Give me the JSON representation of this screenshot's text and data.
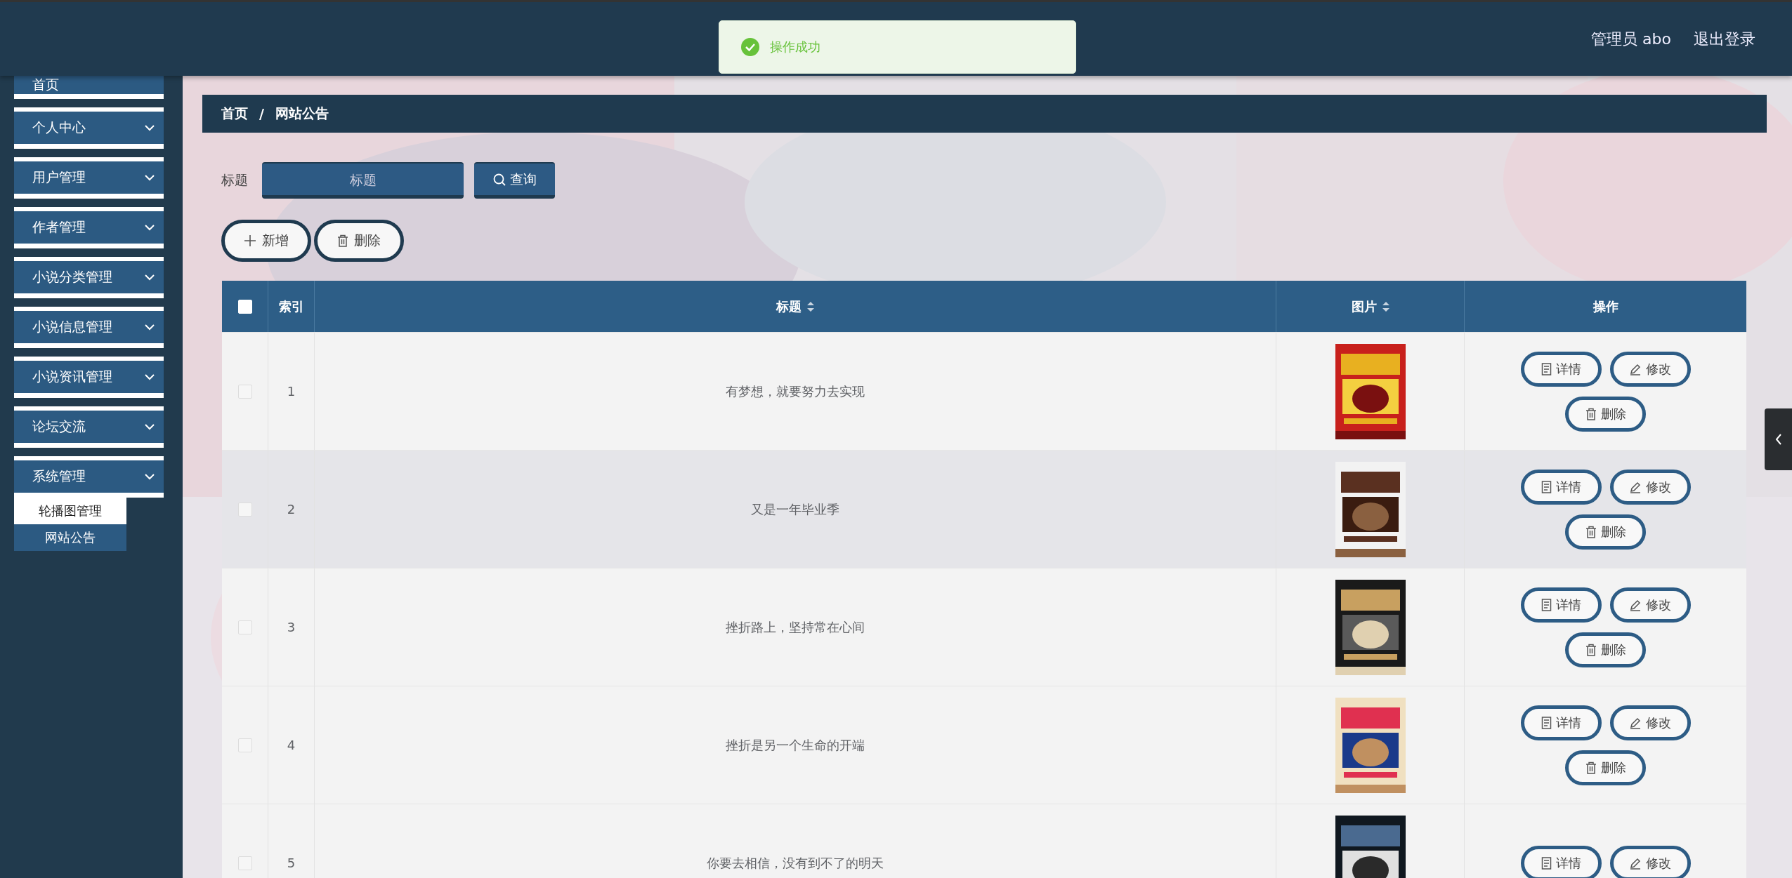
{
  "topbar": {
    "user": "管理员 abo",
    "logout": "退出登录"
  },
  "toast": {
    "message": "操作成功"
  },
  "sidebar": {
    "items": [
      {
        "kind": "link",
        "label": "首页"
      },
      {
        "kind": "menu",
        "label": "个人中心"
      },
      {
        "kind": "menu",
        "label": "用户管理"
      },
      {
        "kind": "menu",
        "label": "作者管理"
      },
      {
        "kind": "menu",
        "label": "小说分类管理"
      },
      {
        "kind": "menu",
        "label": "小说信息管理"
      },
      {
        "kind": "menu",
        "label": "小说资讯管理"
      },
      {
        "kind": "menu",
        "label": "论坛交流"
      },
      {
        "kind": "menu",
        "label": "系统管理",
        "children": [
          {
            "label": "轮播图管理",
            "selected": true
          },
          {
            "label": "网站公告",
            "selected": false
          }
        ]
      }
    ]
  },
  "breadcrumb": {
    "items": [
      "首页",
      "网站公告"
    ],
    "separator": "/"
  },
  "search": {
    "label": "标题",
    "placeholder": "标题",
    "button": "查询"
  },
  "actions": [
    {
      "kind": "add",
      "label": "新增"
    },
    {
      "kind": "delete",
      "label": "删除"
    }
  ],
  "table": {
    "select_all": {
      "checked": false
    },
    "columns": [
      {
        "label": "索引",
        "sortable": false
      },
      {
        "label": "标题",
        "sortable": true
      },
      {
        "label": "图片",
        "sortable": true
      },
      {
        "label": "操作",
        "sortable": false
      }
    ],
    "rows": [
      {
        "checked": false,
        "hovered": false,
        "index": "1",
        "title": "有梦想，就要努力去实现",
        "image": {
          "kind": "picture"
        },
        "actions": [
          {
            "kind": "detail",
            "label": "详情"
          },
          {
            "kind": "edit",
            "label": "修改"
          },
          {
            "kind": "delete",
            "label": "删除"
          }
        ]
      },
      {
        "checked": false,
        "hovered": true,
        "index": "2",
        "title": "又是一年毕业季",
        "image": {
          "kind": "picture"
        },
        "actions": [
          {
            "kind": "detail",
            "label": "详情"
          },
          {
            "kind": "edit",
            "label": "修改"
          },
          {
            "kind": "delete",
            "label": "删除"
          }
        ]
      },
      {
        "checked": false,
        "hovered": false,
        "index": "3",
        "title": "挫折路上，坚持常在心间",
        "image": {
          "kind": "picture"
        },
        "actions": [
          {
            "kind": "detail",
            "label": "详情"
          },
          {
            "kind": "edit",
            "label": "修改"
          },
          {
            "kind": "delete",
            "label": "删除"
          }
        ]
      },
      {
        "checked": false,
        "hovered": false,
        "index": "4",
        "title": "挫折是另一个生命的开端",
        "image": {
          "kind": "picture"
        },
        "actions": [
          {
            "kind": "detail",
            "label": "详情"
          },
          {
            "kind": "edit",
            "label": "修改"
          },
          {
            "kind": "delete",
            "label": "删除"
          }
        ]
      },
      {
        "checked": false,
        "hovered": false,
        "index": "5",
        "title": "你要去相信，没有到不了的明天",
        "image": {
          "kind": "picture"
        },
        "actions": [
          {
            "kind": "detail",
            "label": "详情"
          },
          {
            "kind": "edit",
            "label": "修改"
          }
        ]
      }
    ]
  }
}
